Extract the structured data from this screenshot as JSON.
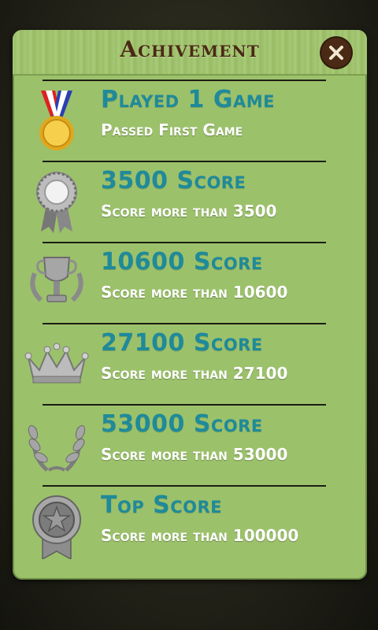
{
  "dialog": {
    "title": "Achivement",
    "close_icon": "close-icon"
  },
  "achievements": [
    {
      "title": "Played 1 Game",
      "desc": "Passed First Game",
      "icon": "gold-medal-icon"
    },
    {
      "title": "3500 Score",
      "desc": "Score more than 3500",
      "icon": "rosette-icon"
    },
    {
      "title": "10600 Score",
      "desc": "Score more than 10600",
      "icon": "trophy-icon"
    },
    {
      "title": "27100 Score",
      "desc": "Score more than 27100",
      "icon": "crown-icon"
    },
    {
      "title": "53000 Score",
      "desc": "Score more than 53000",
      "icon": "laurel-wreath-icon"
    },
    {
      "title": "Top Score",
      "desc": "Score more than 100000",
      "icon": "star-badge-icon"
    }
  ],
  "colors": {
    "panel": "#9cc16b",
    "title_text": "#4a2a14",
    "achievement_title": "#1f8a9a",
    "achievement_desc": "#ffffff"
  }
}
